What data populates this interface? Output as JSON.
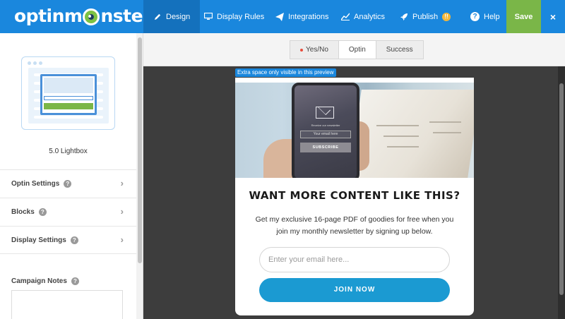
{
  "header": {
    "logo_prefix": "optinm",
    "logo_suffix": "nster",
    "nav": [
      {
        "label": "Design",
        "icon": "pencil-icon"
      },
      {
        "label": "Display Rules",
        "icon": "monitor-icon"
      },
      {
        "label": "Integrations",
        "icon": "paper-plane-icon"
      },
      {
        "label": "Analytics",
        "icon": "line-chart-icon"
      },
      {
        "label": "Publish",
        "icon": "rocket-icon",
        "badge": "!!"
      },
      {
        "label": "Help",
        "icon": "question-icon"
      }
    ],
    "save_label": "Save",
    "close_label": "×",
    "brand_color": "#1a87dd",
    "save_color": "#7ab648"
  },
  "sidebar": {
    "template_name": "5.0 Lightbox",
    "items": [
      {
        "label": "Optin Settings"
      },
      {
        "label": "Blocks"
      },
      {
        "label": "Display Settings"
      }
    ],
    "notes_label": "Campaign Notes",
    "notes_value": ""
  },
  "preview": {
    "tabs": [
      "Yes/No",
      "Optin",
      "Success"
    ],
    "active_tab": "Optin",
    "extra_space_note": "Extra space only visible in this preview",
    "phone": {
      "tagline": "Receive our newsletter",
      "input_placeholder": "Your email here",
      "button": "SUBSCRIBE"
    },
    "title": "WANT MORE CONTENT LIKE THIS?",
    "body": "Get my exclusive 16-page PDF of goodies for free when you join my monthly newsletter by signing up below.",
    "email_placeholder": "Enter your email here...",
    "button_label": "JOIN NOW",
    "button_color": "#1b9ad2"
  }
}
